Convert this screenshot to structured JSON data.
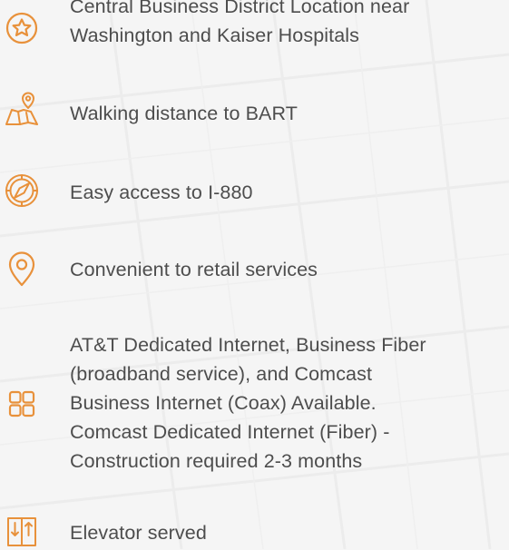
{
  "theme": {
    "accent": "#e8913b",
    "text": "#4d4d4d",
    "background": "#f5f5f5"
  },
  "features": [
    {
      "icon": "star-badge-icon",
      "lines": [
        "Central Business District Location near",
        "Washington and Kaiser Hospitals"
      ]
    },
    {
      "icon": "map-pin-icon",
      "lines": [
        "Walking distance to BART"
      ]
    },
    {
      "icon": "compass-icon",
      "lines": [
        "Easy access to I-880"
      ]
    },
    {
      "icon": "location-pin-icon",
      "lines": [
        "Convenient to retail services"
      ]
    },
    {
      "icon": "grid-icon",
      "lines": [
        "AT&T Dedicated Internet, Business Fiber",
        "(broadband service), and Comcast",
        "Business Internet (Coax) Available.",
        "Comcast Dedicated Internet (Fiber) -",
        "Construction required 2-3 months"
      ]
    },
    {
      "icon": "elevator-icon",
      "lines": [
        "Elevator served"
      ]
    }
  ]
}
